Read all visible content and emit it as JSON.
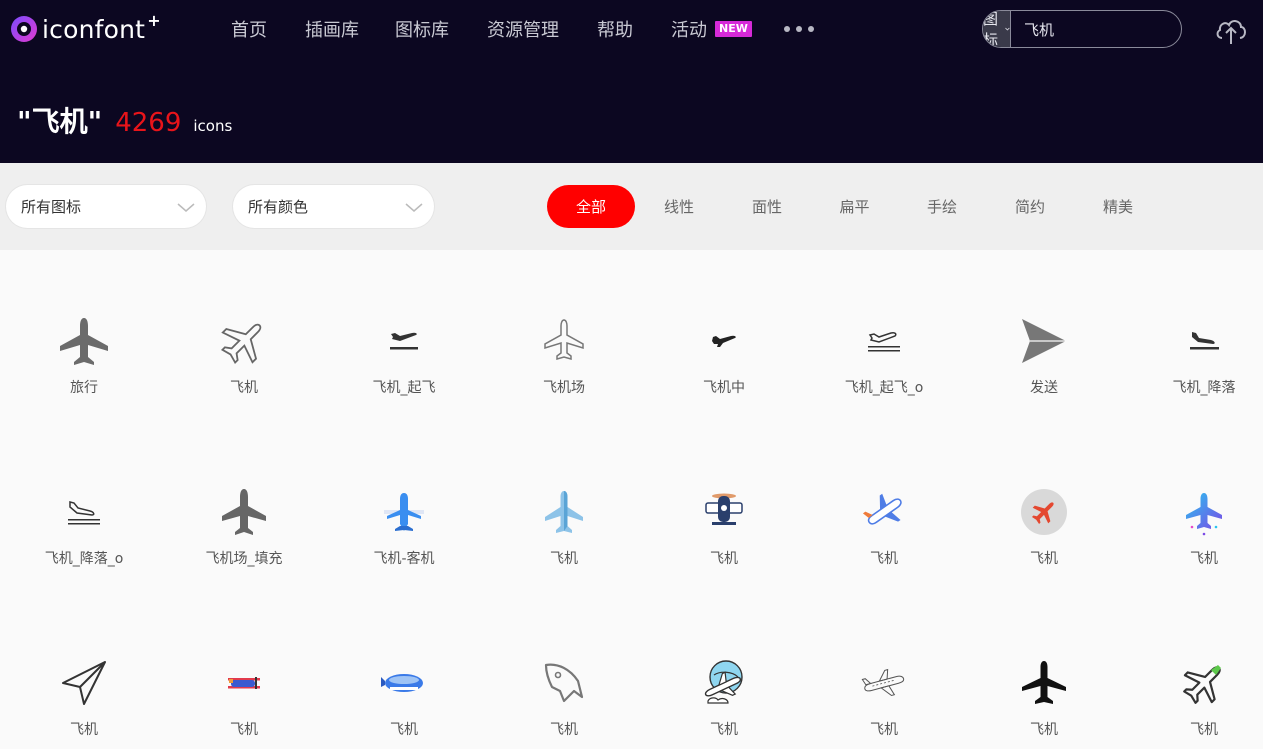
{
  "header": {
    "logo_text": "iconfont",
    "logo_plus": "+",
    "nav": [
      {
        "label": "首页"
      },
      {
        "label": "插画库"
      },
      {
        "label": "图标库"
      },
      {
        "label": "资源管理"
      },
      {
        "label": "帮助"
      },
      {
        "label": "活动",
        "badge": "NEW"
      }
    ],
    "search": {
      "type_label": "图标",
      "value": "飞机"
    },
    "headline": {
      "query": "\"飞机\"",
      "count": "4269",
      "unit": "icons"
    }
  },
  "filters": {
    "icon_type": "所有图标",
    "color": "所有颜色",
    "styles": [
      {
        "label": "全部",
        "active": true
      },
      {
        "label": "线性"
      },
      {
        "label": "面性"
      },
      {
        "label": "扁平"
      },
      {
        "label": "手绘"
      },
      {
        "label": "简约"
      },
      {
        "label": "精美"
      }
    ]
  },
  "icons": [
    {
      "label": "旅行",
      "icon": "airplane-solid-icon"
    },
    {
      "label": "飞机",
      "icon": "airplane-outline-icon"
    },
    {
      "label": "飞机_起飞",
      "icon": "takeoff-icon"
    },
    {
      "label": "飞机场",
      "icon": "airport-outline-icon"
    },
    {
      "label": "飞机中",
      "icon": "airplane-small-icon"
    },
    {
      "label": "飞机_起飞_o",
      "icon": "takeoff-outline-icon"
    },
    {
      "label": "发送",
      "icon": "send-icon"
    },
    {
      "label": "飞机_降落",
      "icon": "landing-icon"
    },
    {
      "label": "飞机_降落_o",
      "icon": "landing-outline-icon"
    },
    {
      "label": "飞机场_填充",
      "icon": "airport-filled-icon"
    },
    {
      "label": "飞机-客机",
      "icon": "airliner-blue-icon"
    },
    {
      "label": "飞机",
      "icon": "airplane-lightblue-icon"
    },
    {
      "label": "飞机",
      "icon": "propeller-plane-icon"
    },
    {
      "label": "飞机",
      "icon": "airplane-flat-icon"
    },
    {
      "label": "飞机",
      "icon": "airplane-red-circle-icon"
    },
    {
      "label": "飞机",
      "icon": "airplane-gradient-icon"
    },
    {
      "label": "飞机",
      "icon": "paper-plane-icon"
    },
    {
      "label": "飞机",
      "icon": "biplane-icon"
    },
    {
      "label": "飞机",
      "icon": "blimp-icon"
    },
    {
      "label": "飞机",
      "icon": "rocket-outline-icon"
    },
    {
      "label": "飞机",
      "icon": "airplane-globe-icon"
    },
    {
      "label": "飞机",
      "icon": "airplane-sketch-icon"
    },
    {
      "label": "飞机",
      "icon": "airplane-black-icon"
    },
    {
      "label": "飞机",
      "icon": "airplane-green-icon"
    }
  ],
  "colors": {
    "brand_red": "#ff0000",
    "header_bg": "#0c0721",
    "count_red": "#e8141a",
    "badge_pink": "#d62ad8"
  }
}
